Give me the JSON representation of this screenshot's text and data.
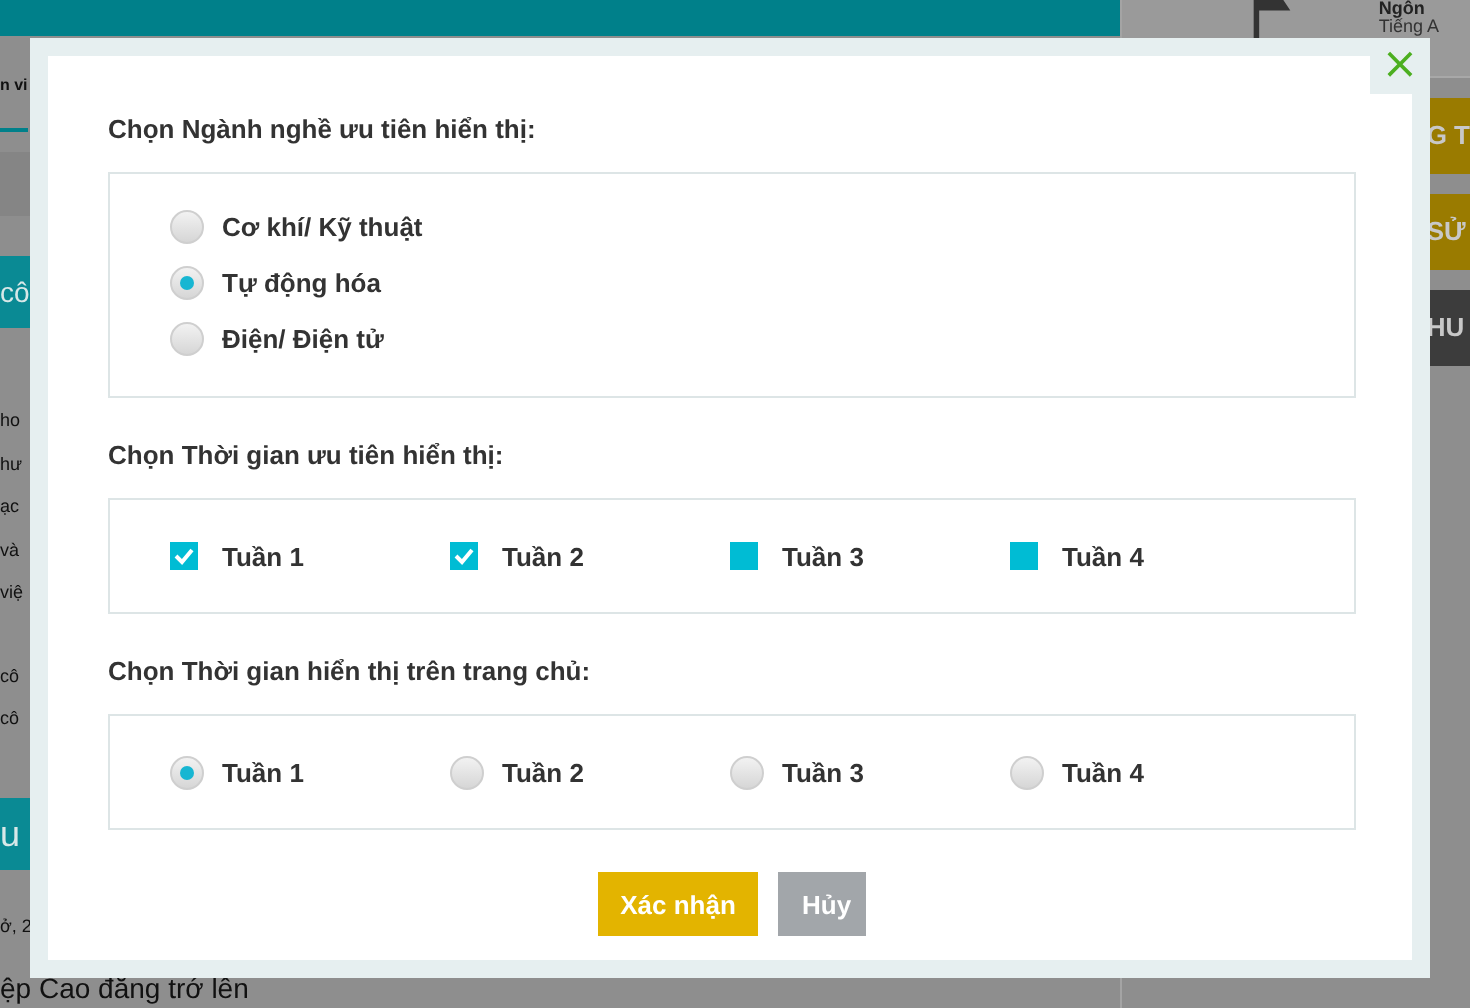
{
  "page_behind": {
    "tab": "n vi",
    "banners": [
      "cô",
      "u"
    ],
    "paragraph_1": [
      "ho",
      "hư",
      "ạc",
      "và",
      "việ"
    ],
    "paragraph_2": [
      "cô",
      "cô"
    ],
    "lines_below": [
      "ở, 2",
      "ệp Cao đăng trớ lên"
    ],
    "profile": {
      "name": "Ngôn",
      "language": "Tiếng A"
    },
    "side_buttons": [
      {
        "label": "G T",
        "kind": "gold"
      },
      {
        "label": "SỬ",
        "kind": "gold"
      },
      {
        "label": "HU",
        "kind": "dark"
      }
    ]
  },
  "dialog": {
    "sections": [
      {
        "title": "Chọn Ngành nghề ưu tiên hiển thị:",
        "kind": "radio-list",
        "options": [
          {
            "label": "Cơ khí/ Kỹ thuật",
            "selected": false
          },
          {
            "label": "Tự động hóa",
            "selected": true
          },
          {
            "label": "Điện/ Điện tử",
            "selected": false
          }
        ]
      },
      {
        "title": "Chọn Thời gian ưu tiên hiển thị:",
        "kind": "checkbox-row",
        "options": [
          {
            "label": "Tuần 1",
            "checked": true
          },
          {
            "label": "Tuần 2",
            "checked": true
          },
          {
            "label": "Tuần 3",
            "checked": false
          },
          {
            "label": "Tuần 4",
            "checked": false
          }
        ]
      },
      {
        "title": "Chọn Thời gian hiển thị trên trang chủ:",
        "kind": "radio-row",
        "options": [
          {
            "label": "Tuần 1",
            "selected": true
          },
          {
            "label": "Tuần 2",
            "selected": false
          },
          {
            "label": "Tuần 3",
            "selected": false
          },
          {
            "label": "Tuần 4",
            "selected": false
          }
        ]
      }
    ],
    "close_button": "×",
    "confirm_button": "Xác nhận",
    "cancel_button": "Hủy"
  }
}
